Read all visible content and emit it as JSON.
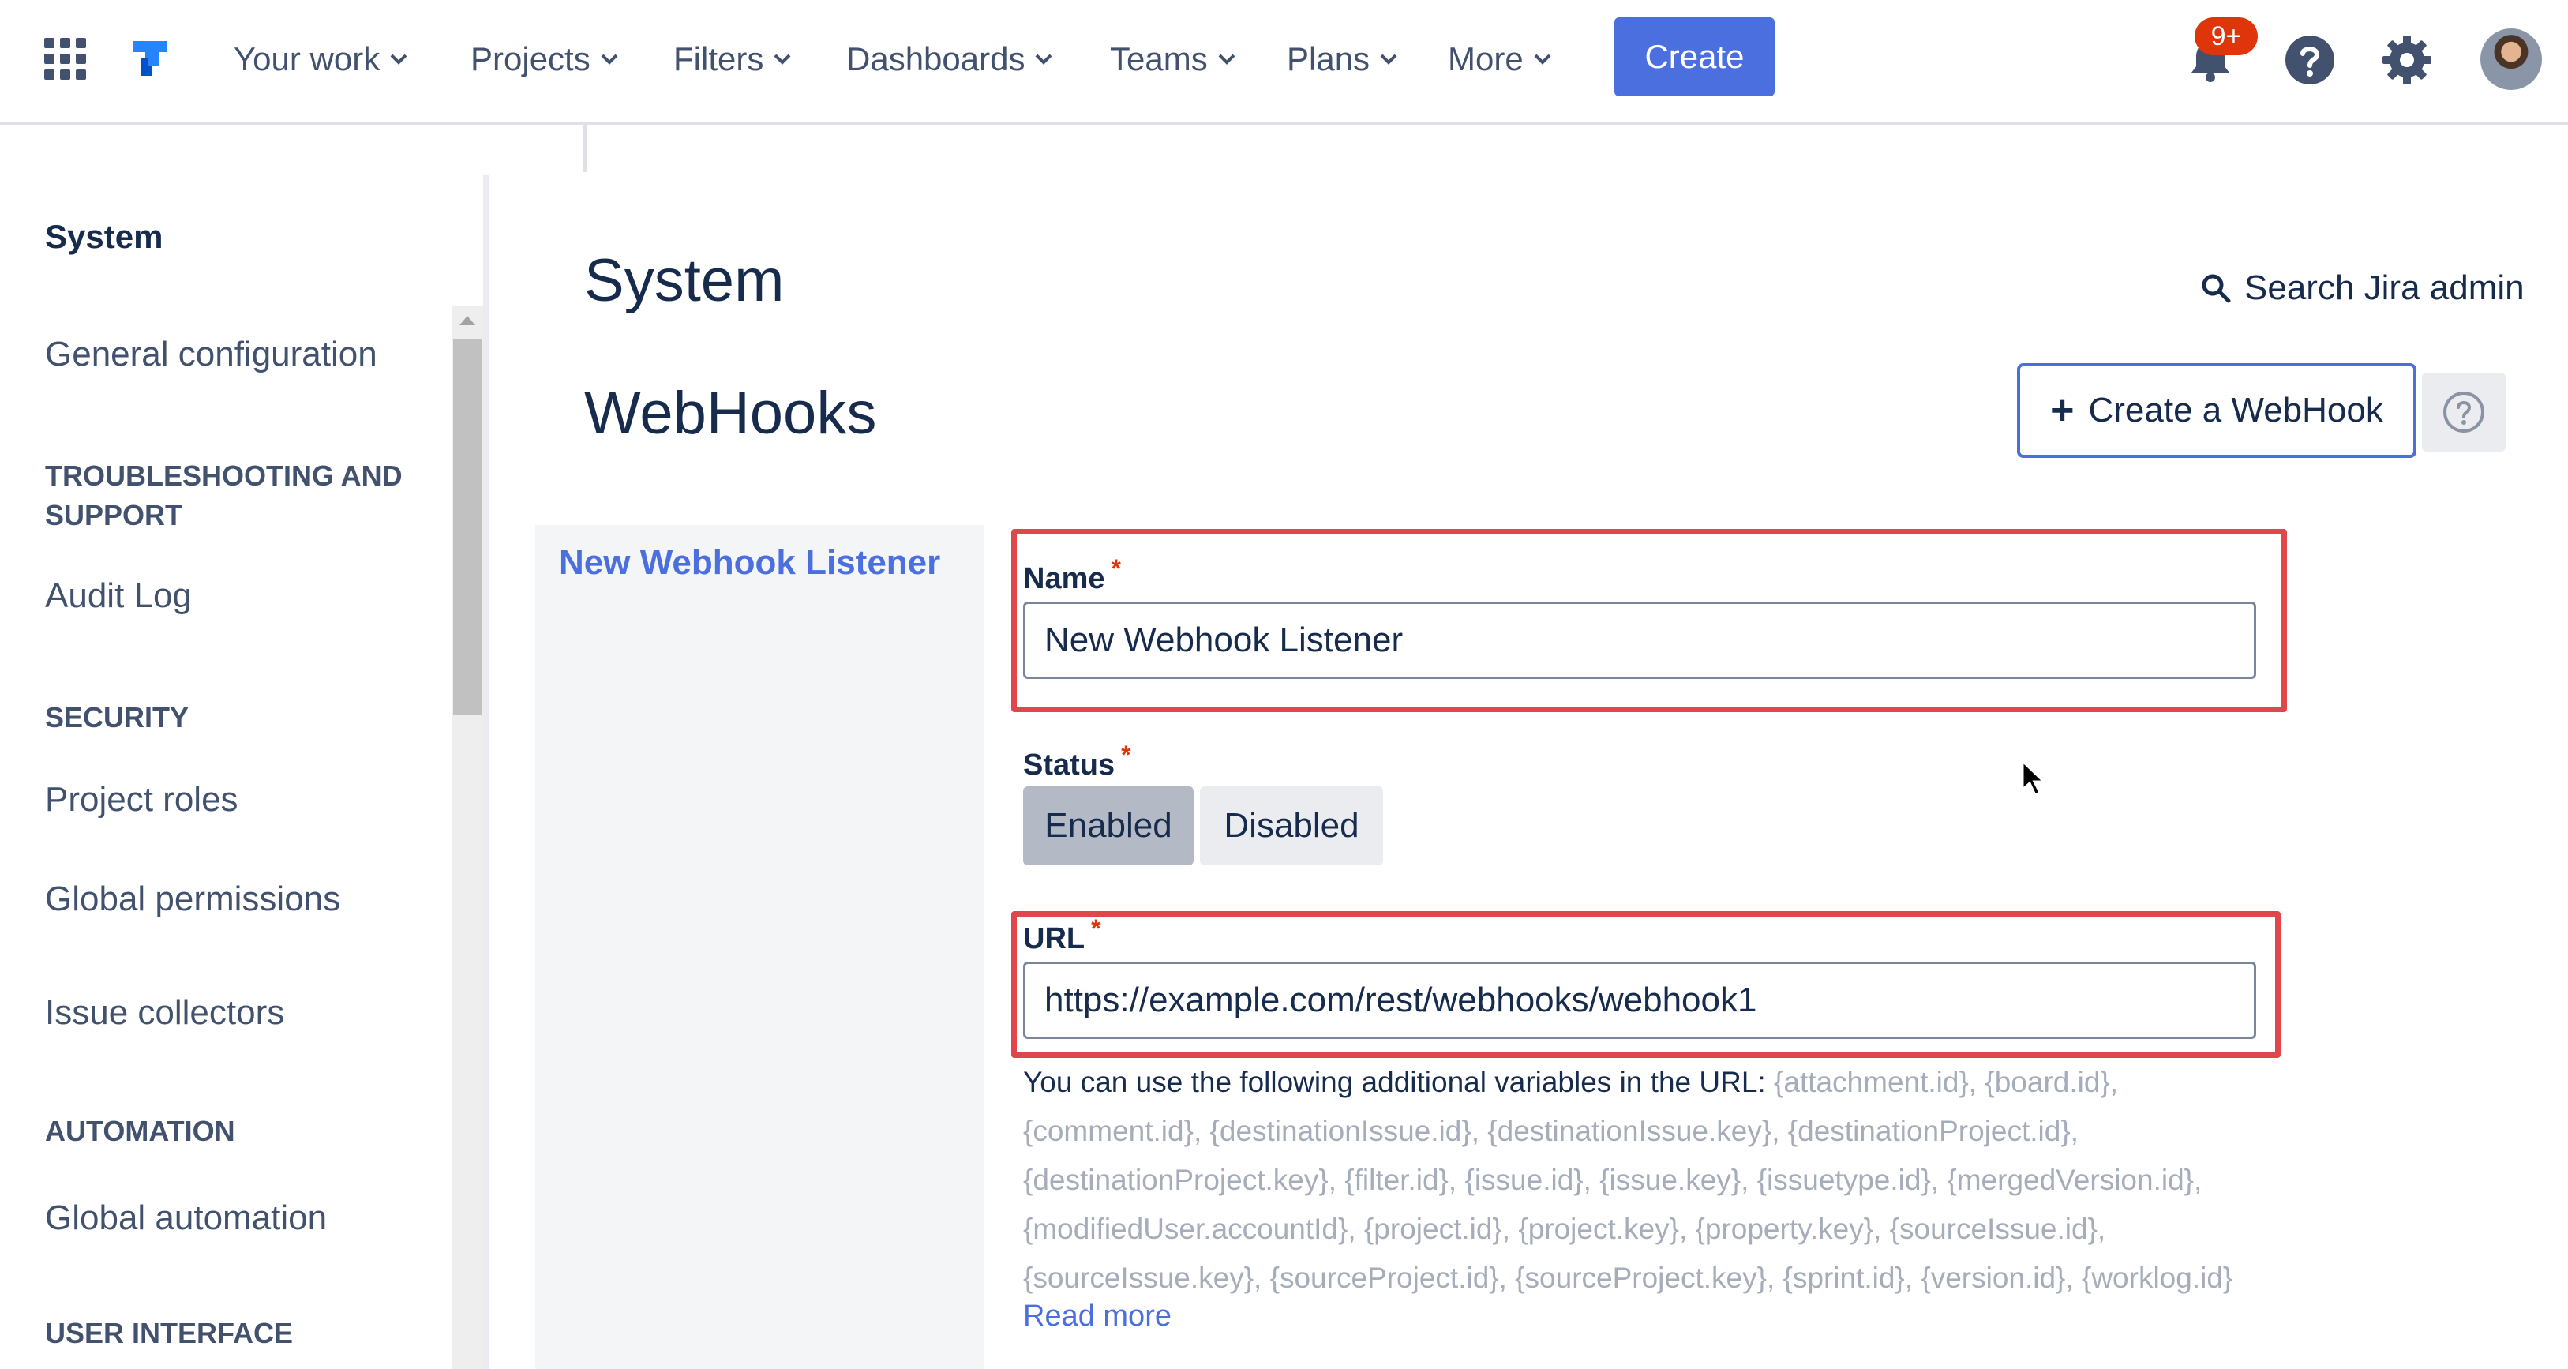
{
  "topnav": {
    "items": [
      {
        "label": "Your work"
      },
      {
        "label": "Projects"
      },
      {
        "label": "Filters"
      },
      {
        "label": "Dashboards"
      },
      {
        "label": "Teams"
      },
      {
        "label": "Plans"
      },
      {
        "label": "More"
      }
    ],
    "create_label": "Create",
    "notification_badge": "9+",
    "icons": [
      "apps-grid-icon",
      "jira-logo-icon",
      "notification-bell-icon",
      "help-icon",
      "gear-icon",
      "avatar"
    ]
  },
  "sidebar": {
    "title": "System",
    "general_configuration": "General configuration",
    "sections": [
      {
        "heading": "TROUBLESHOOTING AND SUPPORT",
        "items": [
          "Audit Log"
        ]
      },
      {
        "heading": "SECURITY",
        "items": [
          "Project roles",
          "Global permissions",
          "Issue collectors"
        ]
      },
      {
        "heading": "AUTOMATION",
        "items": [
          "Global automation"
        ]
      },
      {
        "heading": "USER INTERFACE",
        "items": []
      }
    ]
  },
  "main": {
    "section_title": "System",
    "page_title": "WebHooks",
    "search_admin_label": "Search Jira admin",
    "create_webhook_label": "Create a WebHook",
    "listener_link": "New Webhook Listener",
    "form": {
      "name_label": "Name",
      "name_value": "New Webhook Listener",
      "status_label": "Status",
      "status_options": [
        "Enabled",
        "Disabled"
      ],
      "status_selected": "Enabled",
      "url_label": "URL",
      "url_value": "https://example.com/rest/webhooks/webhook1",
      "required_mark": "*",
      "url_help_prefix": "You can use the following additional variables in the URL: ",
      "url_variables": "{attachment.id}, {board.id}, {comment.id}, {destinationIssue.id}, {destinationIssue.key}, {destinationProject.id}, {destinationProject.key}, {filter.id}, {issue.id}, {issue.key}, {issuetype.id}, {mergedVersion.id}, {modifiedUser.accountId}, {project.id}, {project.key}, {property.key}, {sourceIssue.id}, {sourceIssue.key}, {sourceProject.id}, {sourceProject.key}, {sprint.id}, {version.id}, {worklog.id}",
      "read_more": "Read more"
    }
  },
  "colors": {
    "accent": "#4c6fe0",
    "highlight_box": "#e0474c",
    "required": "#de350b",
    "text": "#172b4d",
    "muted": "#a5adba"
  }
}
